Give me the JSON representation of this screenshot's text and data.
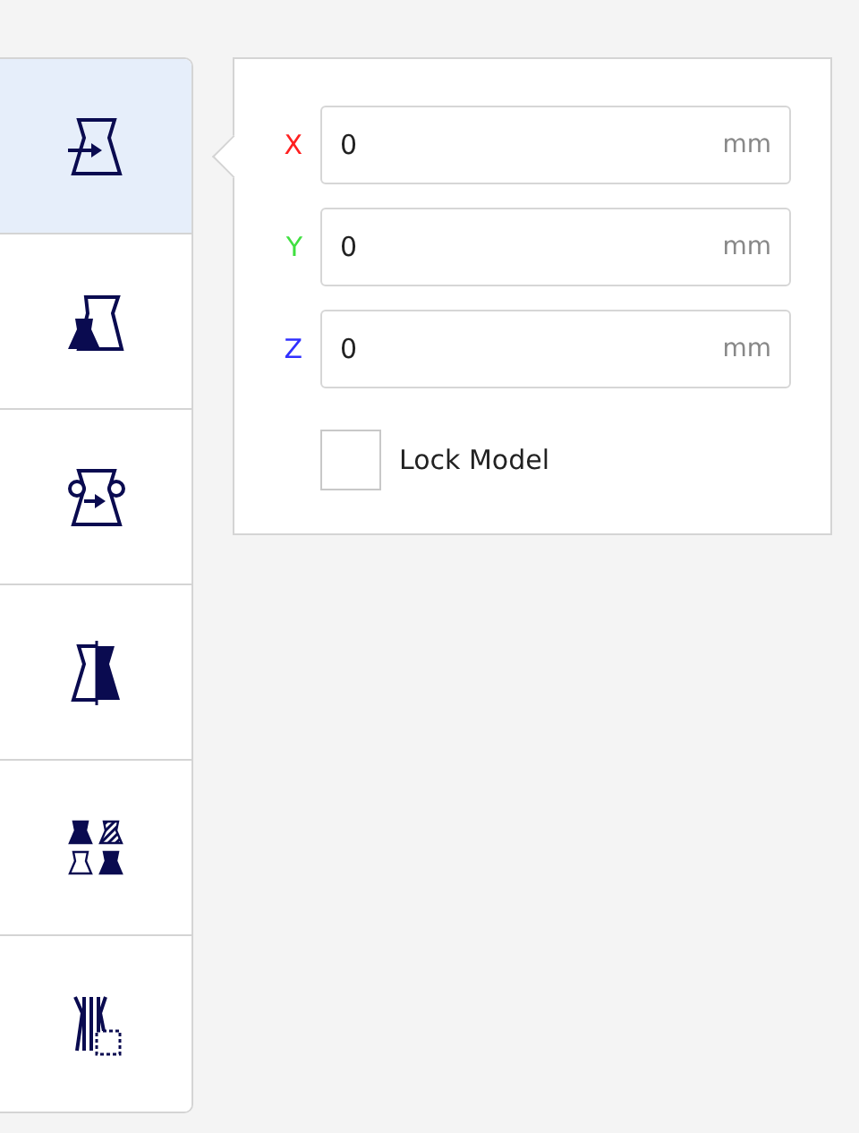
{
  "toolbar": {
    "tools": [
      {
        "kind": "move",
        "selected": true
      },
      {
        "kind": "scale",
        "selected": false
      },
      {
        "kind": "rotate",
        "selected": false
      },
      {
        "kind": "mirror",
        "selected": false
      },
      {
        "kind": "per-model-settings",
        "selected": false
      },
      {
        "kind": "support-blocker",
        "selected": false
      }
    ]
  },
  "move_panel": {
    "axes": [
      {
        "label": "X",
        "color": "#ff2020",
        "value": "0",
        "unit": "mm"
      },
      {
        "label": "Y",
        "color": "#40e040",
        "value": "0",
        "unit": "mm"
      },
      {
        "label": "Z",
        "color": "#3030ff",
        "value": "0",
        "unit": "mm"
      }
    ],
    "lock_model": {
      "label": "Lock Model",
      "checked": false
    }
  }
}
